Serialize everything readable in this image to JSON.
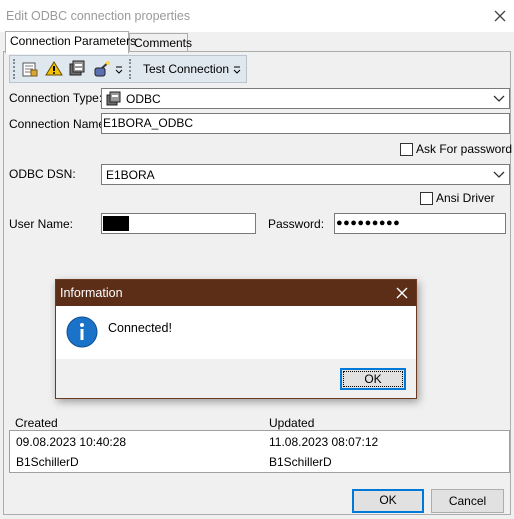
{
  "window": {
    "title": "Edit ODBC connection properties"
  },
  "tabs": [
    {
      "label": "Connection Parameters"
    },
    {
      "label": "Comments"
    }
  ],
  "toolbar": {
    "icons": [
      "properties-icon",
      "warning-icon",
      "db-icon",
      "magic-wand-icon"
    ],
    "test_connection_label": "Test Connection"
  },
  "form": {
    "connection_type_label": "Connection Type:",
    "connection_type_value": "ODBC",
    "connection_name_label": "Connection Name:",
    "connection_name_value": "E1BORA_ODBC",
    "ask_for_password_label": "Ask For password",
    "ask_for_password_checked": false,
    "odbc_dsn_label": "ODBC DSN:",
    "odbc_dsn_value": "E1BORA",
    "ansi_driver_label": "Ansi Driver",
    "ansi_driver_checked": false,
    "user_name_label": "User Name:",
    "password_label": "Password:",
    "password_value": "●●●●●●●●●"
  },
  "dialog": {
    "title": "Information",
    "message": "Connected!",
    "ok_label": "OK"
  },
  "info": {
    "created_label": "Created",
    "updated_label": "Updated",
    "created_date": "09.08.2023 10:40:28",
    "created_by": "B1SchillerD",
    "updated_date": "11.08.2023 08:07:12",
    "updated_by": "B1SchillerD"
  },
  "buttons": {
    "ok_label": "OK",
    "cancel_label": "Cancel"
  },
  "colors": {
    "dialog_title_bar": "#5c2e17",
    "info_icon": "#1a73c9",
    "focus_border": "#0078d7",
    "toolbar_bg": "#dfe7ef"
  }
}
